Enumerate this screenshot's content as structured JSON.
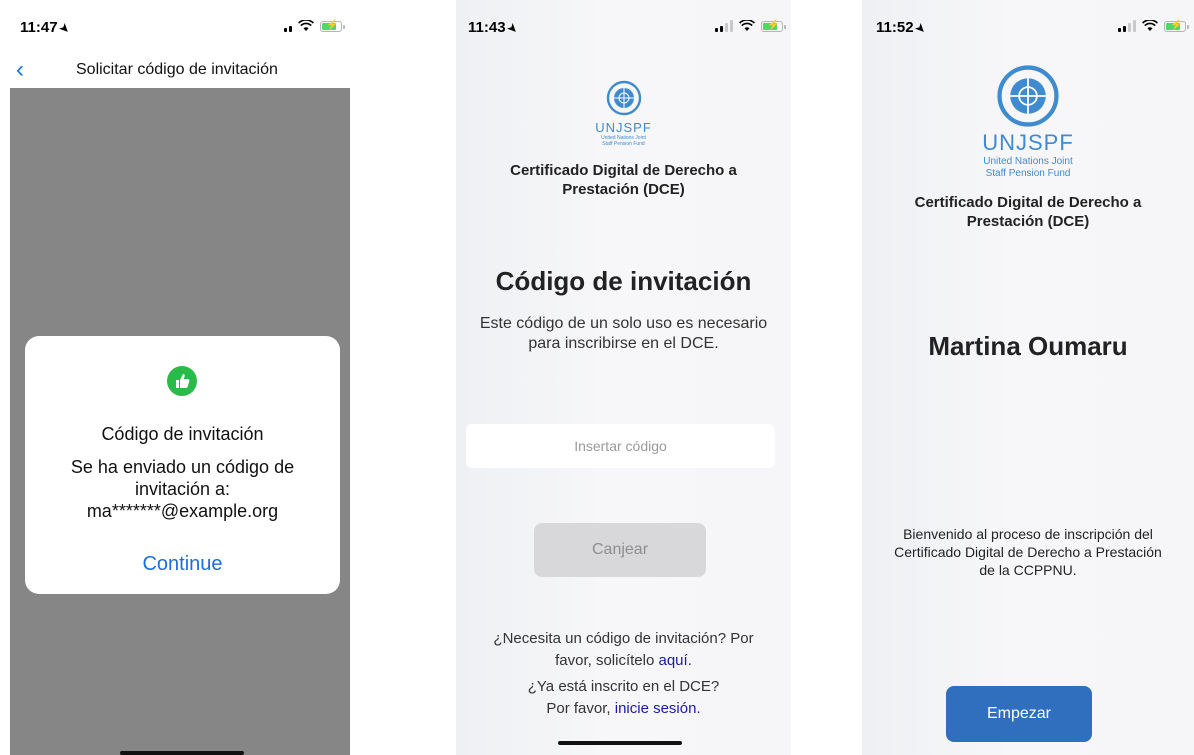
{
  "phone1": {
    "time": "11:47",
    "nav_title": "Solicitar código de invitación",
    "alert": {
      "icon": "thumbs-up-icon",
      "title": "Código de invitación",
      "message_lines": [
        "Se ha enviado un código de",
        "invitación a:",
        "ma*******@example.org"
      ],
      "button": "Continue"
    }
  },
  "phone2": {
    "time": "11:43",
    "logo": {
      "name": "UNJSPF",
      "sub1": "United Nations Joint",
      "sub2": "Staff Pension Fund"
    },
    "cert_title_lines": [
      "Certificado Digital de Derecho a",
      "Prestación (DCE)"
    ],
    "heading": "Código de invitación",
    "description_lines": [
      "Este código de un solo uso es necesario",
      "para inscribirse en el DCE."
    ],
    "code_placeholder": "Insertar código",
    "redeem_label": "Canjear",
    "need_code": {
      "line1": "¿Necesita un código de invitación? Por",
      "line2_prefix": "favor, solicítelo",
      "link": "aquí."
    },
    "enrolled": {
      "line1": "¿Ya está inscrito en el DCE?",
      "line2_prefix": "Por favor,",
      "link": "inicie sesión."
    }
  },
  "phone3": {
    "time": "11:52",
    "logo": {
      "name": "UNJSPF",
      "sub1": "United Nations Joint",
      "sub2": "Staff Pension Fund"
    },
    "cert_title_lines": [
      "Certificado Digital de Derecho a",
      "Prestación (DCE)"
    ],
    "user_name": "Martina Oumaru",
    "welcome_lines": [
      "Bienvenido al proceso de inscripción del",
      "Certificado Digital de Derecho a Prestación",
      "de la CCPPNU."
    ],
    "start_label": "Empezar"
  },
  "colors": {
    "link": "#1a73e8",
    "accent": "#2f6fbd",
    "success": "#2aba4a",
    "logo": "#3f8bd0"
  }
}
